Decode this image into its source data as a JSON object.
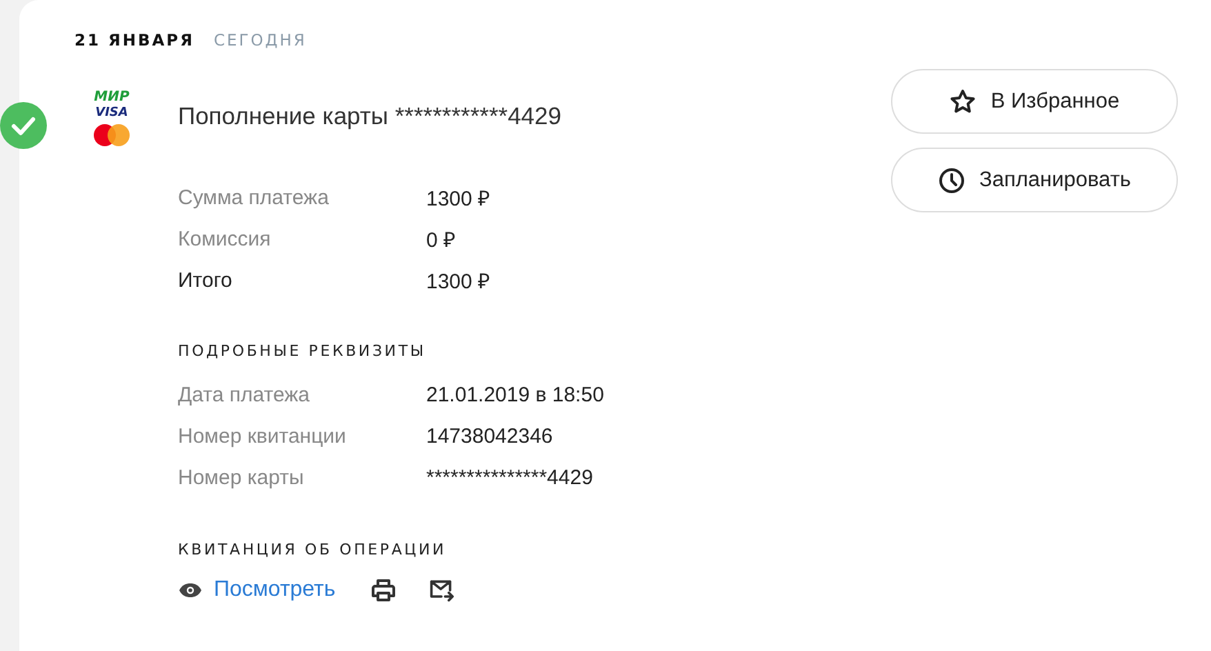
{
  "date": {
    "day": "21 ЯНВАРЯ",
    "relative": "СЕГОДНЯ"
  },
  "operation": {
    "completed": true,
    "logos": [
      "МИР",
      "VISA"
    ],
    "title": "Пополнение карты ************4429"
  },
  "summary": [
    {
      "label": "Сумма платежа",
      "value": "1300 ₽",
      "total": false
    },
    {
      "label": "Комиссия",
      "value": "0 ₽",
      "total": false
    },
    {
      "label": "Итого",
      "value": "1300 ₽",
      "total": true
    }
  ],
  "details": {
    "heading": "ПОДРОБНЫЕ РЕКВИЗИТЫ",
    "rows": [
      {
        "label": "Дата платежа",
        "value": "21.01.2019 в 18:50"
      },
      {
        "label": "Номер квитанции",
        "value": "14738042346"
      },
      {
        "label": "Номер карты",
        "value": "***************4429"
      }
    ]
  },
  "receipt": {
    "heading": "КВИТАНЦИЯ ОБ ОПЕРАЦИИ",
    "view_link": "Посмотреть"
  },
  "actions": [
    {
      "kind": "favorite",
      "label": "В Избранное"
    },
    {
      "kind": "schedule",
      "label": "Запланировать"
    }
  ]
}
